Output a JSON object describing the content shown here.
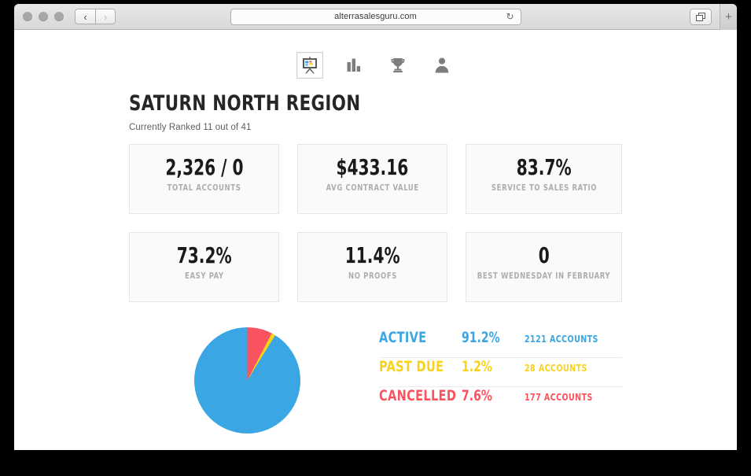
{
  "browser": {
    "url": "alterrasalesguru.com",
    "back_label": "‹",
    "forward_label": "›",
    "reload_label": "↻",
    "tabs_label": "❐",
    "new_tab_label": "+"
  },
  "icon_nav": [
    {
      "name": "presentation-icon",
      "label": "Dashboard",
      "active": true
    },
    {
      "name": "bar-chart-icon",
      "label": "Reports",
      "active": false
    },
    {
      "name": "trophy-icon",
      "label": "Rankings",
      "active": false
    },
    {
      "name": "person-icon",
      "label": "Profile",
      "active": false
    }
  ],
  "header": {
    "title": "SATURN NORTH REGION",
    "subtitle": "Currently Ranked 11 out of 41"
  },
  "stats": [
    {
      "value": "2,326 / 0",
      "label": "TOTAL ACCOUNTS"
    },
    {
      "value": "$433.16",
      "label": "AVG CONTRACT VALUE"
    },
    {
      "value": "83.7%",
      "label": "SERVICE TO SALES RATIO"
    },
    {
      "value": "73.2%",
      "label": "EASY PAY"
    },
    {
      "value": "11.4%",
      "label": "NO PROOFS"
    },
    {
      "value": "0",
      "label": "BEST WEDNESDAY IN FEBRUARY"
    }
  ],
  "legend": [
    {
      "name": "ACTIVE",
      "percent": "91.2%",
      "accounts": "2121 ACCOUNTS",
      "color": "#3aa6e3"
    },
    {
      "name": "PAST DUE",
      "percent": "1.2%",
      "accounts": "28 ACCOUNTS",
      "color": "#f8d21c"
    },
    {
      "name": "CANCELLED",
      "percent": "7.6%",
      "accounts": "177 ACCOUNTS",
      "color": "#f9535f"
    }
  ],
  "chart_data": {
    "type": "pie",
    "title": "",
    "labels": [
      "ACTIVE",
      "PAST DUE",
      "CANCELLED"
    ],
    "values": [
      91.2,
      1.2,
      7.6
    ],
    "counts": [
      2121,
      28,
      177
    ],
    "colors": [
      "#3aa6e3",
      "#f8d21c",
      "#f9535f"
    ],
    "units": "percent",
    "legend_position": "right",
    "start_angle_deg": 0,
    "direction": "counterclockwise",
    "total_accounts": 2326
  },
  "colors": {
    "active": "#3aa6e3",
    "past_due": "#f8d21c",
    "cancelled": "#f9535f",
    "card_bg": "#fafafa",
    "card_border": "#e6e6e6",
    "title": "#262626"
  }
}
